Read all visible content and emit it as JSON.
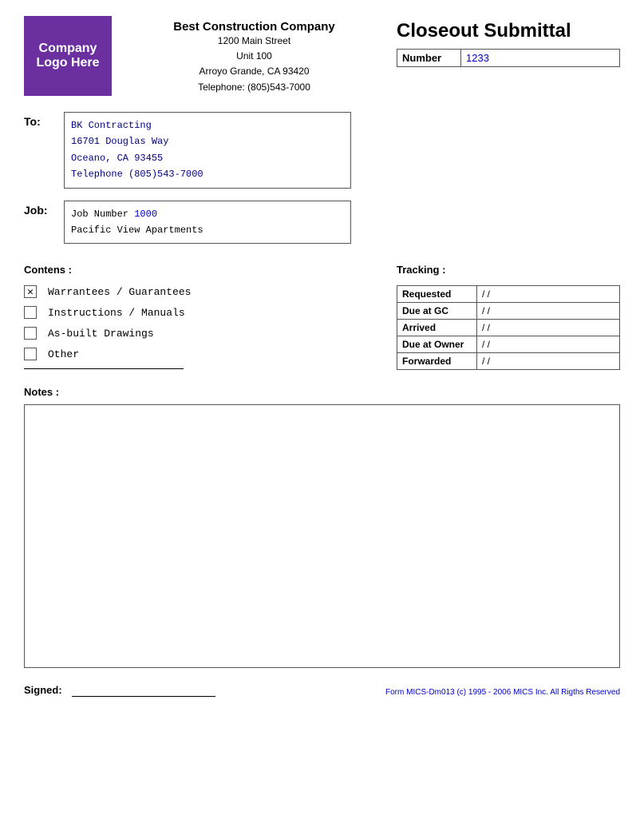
{
  "logo": {
    "text": "Company Logo Here",
    "bg_color": "#6B2FA0"
  },
  "company": {
    "name": "Best Construction Company",
    "address1": "1200 Main Street",
    "address2": "Unit 100",
    "address3": "Arroyo Grande, CA 93420",
    "phone": "Telephone: (805)543-7000"
  },
  "title": "Closeout Submittal",
  "number_label": "Number",
  "number_value": "1233",
  "to_label": "To:",
  "to_address": "BK Contracting\n16701 Douglas Way\nOceano, CA 93455\nTelephone (805)543-7000",
  "job_label": "Job:",
  "job_number_label": "Job Number",
  "job_number_value": "1000",
  "job_name": "Pacific View Apartments",
  "contents_label": "Contens :",
  "contents_items": [
    {
      "label": "Warrantees / Guarantees",
      "checked": true
    },
    {
      "label": "Instructions / Manuals",
      "checked": false
    },
    {
      "label": "As-built Drawings",
      "checked": false
    },
    {
      "label": "Other",
      "checked": false
    }
  ],
  "tracking_label": "Tracking :",
  "tracking_rows": [
    {
      "label": "Requested",
      "value": "/ /"
    },
    {
      "label": "Due at GC",
      "value": "/ /"
    },
    {
      "label": "Arrived",
      "value": "/ /"
    },
    {
      "label": "Due at Owner",
      "value": "/ /"
    },
    {
      "label": "Forwarded",
      "value": "/ /"
    }
  ],
  "notes_label": "Notes :",
  "signed_label": "Signed:",
  "form_id": "Form MICS-Dm013 (c) 1995 - 2006 MICS Inc. All Rigths Reserved"
}
